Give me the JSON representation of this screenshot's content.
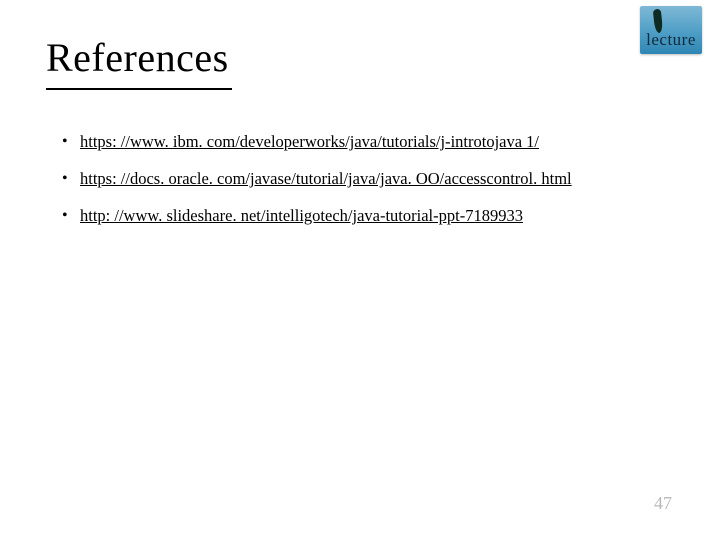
{
  "logo": {
    "text": "lecture"
  },
  "title": "References",
  "references": [
    {
      "text": "https: //www. ibm. com/developerworks/java/tutorials/j-introtojava 1/"
    },
    {
      "text": "https: //docs. oracle. com/javase/tutorial/java/java. OO/accesscontrol. html"
    },
    {
      "text": "http: //www. slideshare. net/intelligotech/java-tutorial-ppt-7189933"
    }
  ],
  "page_number": "47"
}
